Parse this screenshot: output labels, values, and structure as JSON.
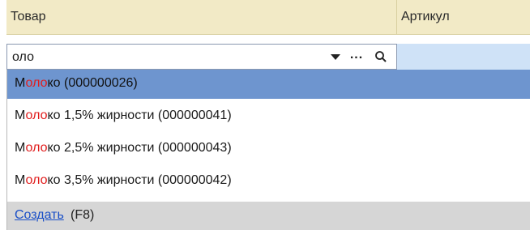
{
  "header": {
    "col_goods": "Товар",
    "col_article": "Артикул"
  },
  "search": {
    "value": "оло",
    "dropdown_icon": "chevron-down-icon",
    "select_icon": "ellipsis-icon",
    "search_icon": "search-icon"
  },
  "results": [
    {
      "pre": "М",
      "match": "оло",
      "post": "ко (000000026)",
      "selected": true
    },
    {
      "pre": "М",
      "match": "оло",
      "post": "ко 1,5% жирности (000000041)",
      "selected": false
    },
    {
      "pre": "М",
      "match": "оло",
      "post": "ко 2,5% жирности (000000043)",
      "selected": false
    },
    {
      "pre": "М",
      "match": "оло",
      "post": "ко 3,5% жирности (000000042)",
      "selected": false
    }
  ],
  "footer": {
    "create_label": "Создать",
    "create_hint": "(F8)"
  },
  "colors": {
    "header_bg": "#f2eac6",
    "selected_bg": "#6e95cf",
    "match_color": "#e11d1d",
    "article_bg": "#cfe2f7",
    "link_color": "#1a4fc7"
  }
}
